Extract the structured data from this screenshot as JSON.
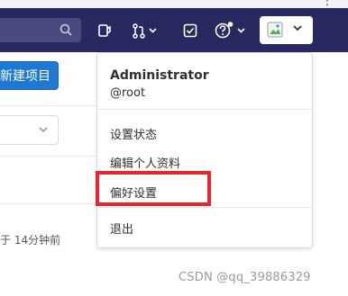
{
  "navbar": {
    "bg_color": "#292961",
    "search_icon": "search-icon",
    "icons": [
      "todo-list-icon",
      "merge-request-icon",
      "issues-icon",
      "help-icon"
    ]
  },
  "left_content": {
    "new_project_label": "新建项目",
    "updated_text": "于 14分钟前"
  },
  "dropdown": {
    "user_name": "Administrator",
    "username": "@root",
    "items": [
      "设置状态",
      "编辑个人资料",
      "偏好设置"
    ],
    "signout_label": "退出"
  },
  "highlight_color": "#e8262d",
  "watermark": "CSDN @qq_39886329"
}
